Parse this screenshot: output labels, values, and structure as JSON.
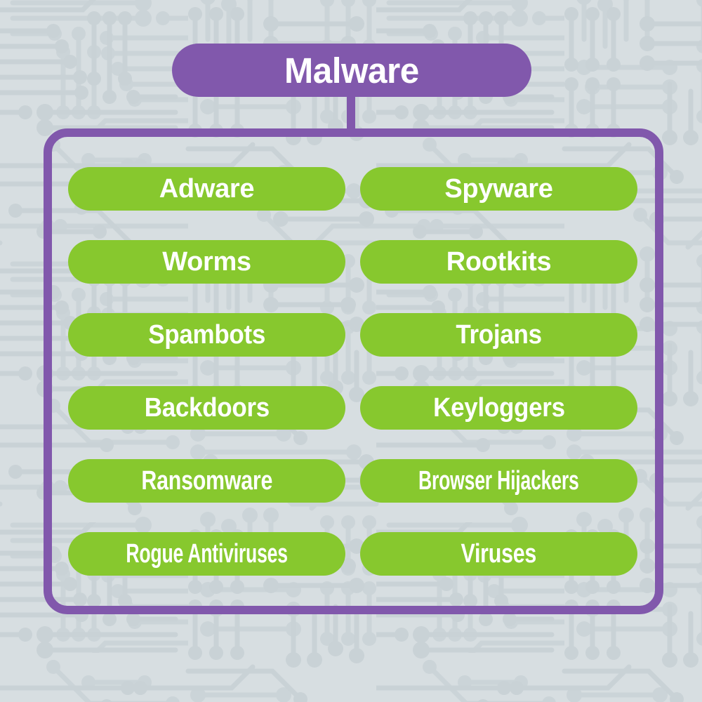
{
  "theme": {
    "background_color": "#d7dee1",
    "circuit_trace_color": "#c9d2d6",
    "accent_purple": "#8158ac",
    "accent_green": "#87c82e",
    "label_color": "#ffffff"
  },
  "header": {
    "title": "Malware"
  },
  "diagram": {
    "columns": 2,
    "rows": 6,
    "items": [
      {
        "label": "Adware",
        "column": "left",
        "row": 1,
        "squeeze": 0
      },
      {
        "label": "Spyware",
        "column": "right",
        "row": 1,
        "squeeze": 0
      },
      {
        "label": "Worms",
        "column": "left",
        "row": 2,
        "squeeze": 0
      },
      {
        "label": "Rootkits",
        "column": "right",
        "row": 2,
        "squeeze": 0
      },
      {
        "label": "Spambots",
        "column": "left",
        "row": 3,
        "squeeze": 1
      },
      {
        "label": "Trojans",
        "column": "right",
        "row": 3,
        "squeeze": 1
      },
      {
        "label": "Backdoors",
        "column": "left",
        "row": 4,
        "squeeze": 1
      },
      {
        "label": "Keyloggers",
        "column": "right",
        "row": 4,
        "squeeze": 1
      },
      {
        "label": "Ransomware",
        "column": "left",
        "row": 5,
        "squeeze": 2
      },
      {
        "label": "Browser Hijackers",
        "column": "right",
        "row": 5,
        "squeeze": 3
      },
      {
        "label": "Rogue Antiviruses",
        "column": "left",
        "row": 6,
        "squeeze": 3
      },
      {
        "label": "Viruses",
        "column": "right",
        "row": 6,
        "squeeze": 2
      }
    ]
  }
}
